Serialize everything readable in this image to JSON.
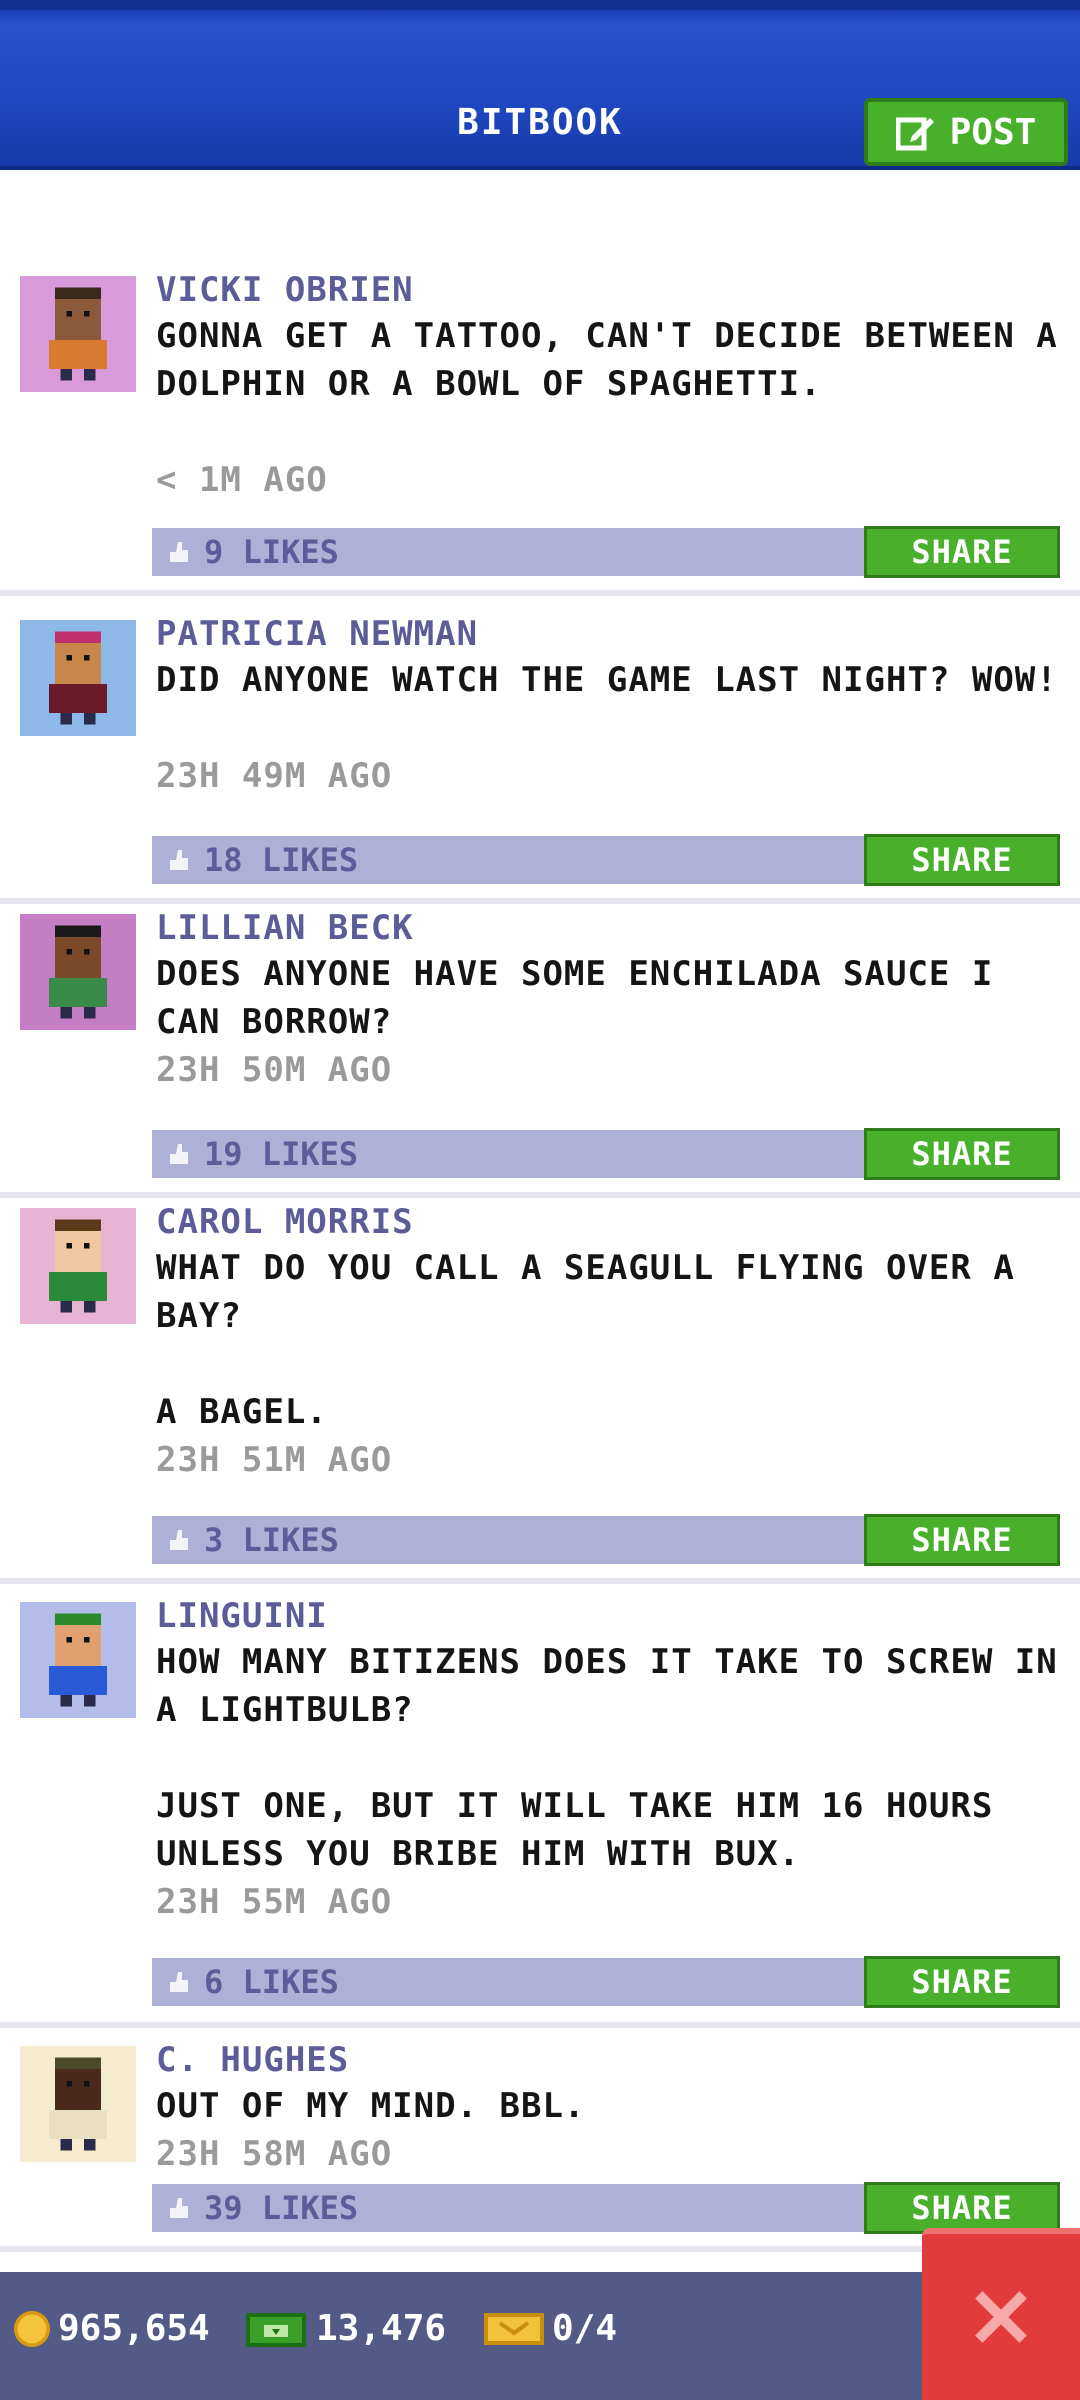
{
  "header": {
    "title": "BITBOOK",
    "post_label": "POST"
  },
  "posts": [
    {
      "name": "VICKI OBRIEN",
      "message": "GONNA GET A TATTOO, CAN'T DECIDE BETWEEN A DOLPHIN OR A BOWL OF SPAGHETTI.",
      "time": "< 1M AGO",
      "likes": "9 LIKES",
      "share": "SHARE",
      "avatar_color": "#d89ad8"
    },
    {
      "name": "PATRICIA NEWMAN",
      "message": "DID ANYONE WATCH THE GAME LAST NIGHT? WOW!",
      "time": "23H 49M AGO",
      "likes": "18 LIKES",
      "share": "SHARE",
      "avatar_color": "#8db8e8"
    },
    {
      "name": "LILLIAN BECK",
      "message": "DOES ANYONE HAVE SOME ENCHILADA SAUCE I CAN BORROW?",
      "time": "23H 50M AGO",
      "likes": "19 LIKES",
      "share": "SHARE",
      "avatar_color": "#c47ec4"
    },
    {
      "name": "CAROL MORRIS",
      "message": "WHAT DO YOU CALL A SEAGULL FLYING OVER A BAY?\n\nA BAGEL.",
      "time": "23H 51M AGO",
      "likes": "3 LIKES",
      "share": "SHARE",
      "avatar_color": "#e8b4d4"
    },
    {
      "name": "LINGUINI",
      "message": "HOW MANY BITIZENS DOES IT TAKE TO SCREW IN A LIGHTBULB?\n\nJUST ONE, BUT IT WILL TAKE HIM 16 HOURS UNLESS YOU BRIBE HIM WITH BUX.",
      "time": "23H 55M AGO",
      "likes": "6 LIKES",
      "share": "SHARE",
      "avatar_color": "#b4bce8"
    },
    {
      "name": "C. HUGHES",
      "message": "OUT OF MY MIND. BBL.",
      "time": "23H 58M AGO",
      "likes": "39 LIKES",
      "share": "SHARE",
      "avatar_color": "#f5ecd0"
    }
  ],
  "footer": {
    "coins": "965,654",
    "bux": "13,476",
    "tickets": "0/4"
  },
  "colors": {
    "accent_green": "#49b02c",
    "header_blue": "#1f47bf",
    "like_bar": "#aeb0d6",
    "close_red": "#e23b3b"
  }
}
